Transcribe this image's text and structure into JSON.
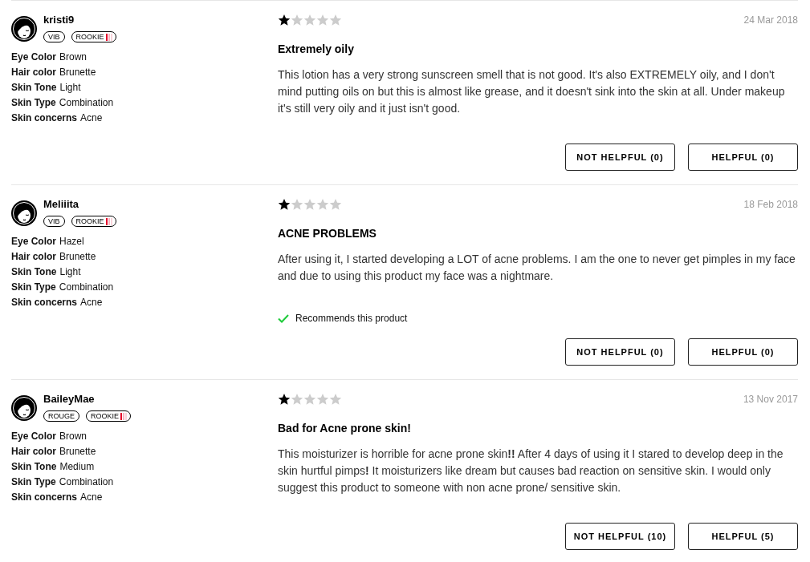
{
  "reviews": [
    {
      "reviewer": {
        "username": "kristi9",
        "badges": [
          {
            "label": "VIB",
            "kind": "status"
          },
          {
            "label": "ROOKIE",
            "kind": "rank"
          }
        ],
        "attributes": [
          {
            "label": "Eye Color",
            "value": "Brown"
          },
          {
            "label": "Hair color",
            "value": "Brunette"
          },
          {
            "label": "Skin Tone",
            "value": "Light"
          },
          {
            "label": "Skin Type",
            "value": "Combination"
          },
          {
            "label": "Skin concerns",
            "value": "Acne"
          }
        ]
      },
      "stars": 1,
      "date": "24 Mar 2018",
      "title": "Extremely oily",
      "body": "This lotion has a very strong sunscreen smell that is not good. It's also EXTREMELY oily, and I don't mind putting oils on but this is almost like grease, and it doesn't sink into the skin at all. Under makeup it's still very oily and it just isn't good.",
      "buttons": [
        "NOT HELPFUL (0)",
        "HELPFUL (0)"
      ]
    },
    {
      "reviewer": {
        "username": "Meliiita",
        "badges": [
          {
            "label": "VIB",
            "kind": "status"
          },
          {
            "label": "ROOKIE",
            "kind": "rank"
          }
        ],
        "attributes": [
          {
            "label": "Eye Color",
            "value": "Hazel"
          },
          {
            "label": "Hair color",
            "value": "Brunette"
          },
          {
            "label": "Skin Tone",
            "value": "Light"
          },
          {
            "label": "Skin Type",
            "value": "Combination"
          },
          {
            "label": "Skin concerns",
            "value": "Acne"
          }
        ]
      },
      "stars": 1,
      "date": "18 Feb 2018",
      "title": "ACNE PROBLEMS",
      "body": "After using it, I started developing a LOT of acne problems. I am the one to never get pimples in my face and due to using this product my face was a nightmare.",
      "recommendation": "Recommends this product",
      "buttons": [
        "NOT HELPFUL (0)",
        "HELPFUL (0)"
      ]
    },
    {
      "reviewer": {
        "username": "BaileyMae",
        "badges": [
          {
            "label": "ROUGE",
            "kind": "status"
          },
          {
            "label": "ROOKIE",
            "kind": "rank"
          }
        ],
        "attributes": [
          {
            "label": "Eye Color",
            "value": "Brown"
          },
          {
            "label": "Hair color",
            "value": "Brunette"
          },
          {
            "label": "Skin Tone",
            "value": "Medium"
          },
          {
            "label": "Skin Type",
            "value": "Combination"
          },
          {
            "label": "Skin concerns",
            "value": "Acne"
          }
        ]
      },
      "stars": 1,
      "date": "13 Nov 2017",
      "title": "Bad for Acne prone skin!",
      "body": "This moisturizer is horrible for acne prone skin**!!** After 4 days of using it I stared to develop deep in the skin hurtful pimps**!** It moisturizers like dream but causes bad reaction on sensitive skin. I would only suggest this product to someone with non acne prone/ sensitive skin.",
      "buttons": [
        "NOT HELPFUL (10)",
        "HELPFUL (5)"
      ]
    }
  ]
}
